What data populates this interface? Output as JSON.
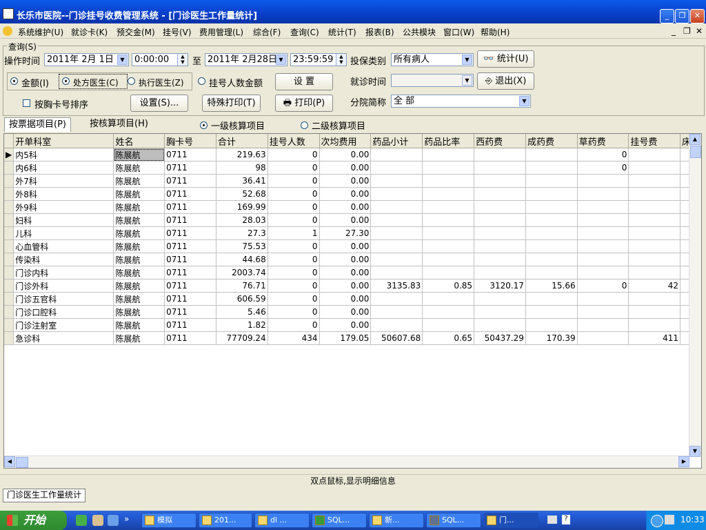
{
  "window": {
    "title": "长乐市医院--门诊挂号收费管理系统 - [门诊医生工作量统计]"
  },
  "menu": [
    "系统维护(U)",
    "就诊卡(K)",
    "预交金(M)",
    "挂号(V)",
    "费用管理(L)",
    "综合(F)",
    "查询(C)",
    "统计(T)",
    "报表(B)",
    "公共模块",
    "窗口(W)",
    "帮助(H)"
  ],
  "query": {
    "group_label": "查询(S)",
    "op_time_label": "操作时间",
    "date_from": "2011年 2月 1日",
    "time_from": "0:00:00",
    "to_label": "至",
    "date_to": "2011年 2月28日",
    "time_to": "23:59:59",
    "insurance_label": "投保类别",
    "insurance_value": "所有病人",
    "stat_button": "统计(U)",
    "radio_amount": "金额(I)",
    "radio_rx_doctor": "处方医生(C)",
    "radio_exec_doctor": "执行医生(Z)",
    "radio_reg_count": "挂号人数金额",
    "set_button": "设  置",
    "visit_time_label": "就诊时间",
    "visit_time_value": "",
    "exit_button": "退出(X)",
    "chk_sort_card": "按胸卡号排序",
    "settings_button": "设置(S)...",
    "special_print_button": "特殊打印(T)",
    "print_button": "打印(P)",
    "branch_label": "分院简称",
    "branch_value": "全 部"
  },
  "tabs": {
    "by_receipt": "按票据项目(P)",
    "by_account": "按核算项目(H)",
    "level1": "一级核算项目",
    "level2": "二级核算项目"
  },
  "grid": {
    "columns": [
      "开单科室",
      "姓名",
      "胸卡号",
      "合计",
      "挂号人数",
      "次均费用",
      "药品小计",
      "药品比率",
      "西药费",
      "成药费",
      "草药费",
      "挂号费",
      "床"
    ],
    "rows": [
      [
        "内5科",
        "陈展航",
        "0711",
        "219.63",
        "0",
        "0.00",
        "",
        "",
        "",
        "",
        "0",
        "",
        ""
      ],
      [
        "内6科",
        "陈展航",
        "0711",
        "98",
        "0",
        "0.00",
        "",
        "",
        "",
        "",
        "0",
        "",
        ""
      ],
      [
        "外7科",
        "陈展航",
        "0711",
        "36.41",
        "0",
        "0.00",
        "",
        "",
        "",
        "",
        "",
        "",
        ""
      ],
      [
        "外8科",
        "陈展航",
        "0711",
        "52.68",
        "0",
        "0.00",
        "",
        "",
        "",
        "",
        "",
        "",
        ""
      ],
      [
        "外9科",
        "陈展航",
        "0711",
        "169.99",
        "0",
        "0.00",
        "",
        "",
        "",
        "",
        "",
        "",
        ""
      ],
      [
        "妇科",
        "陈展航",
        "0711",
        "28.03",
        "0",
        "0.00",
        "",
        "",
        "",
        "",
        "",
        "",
        ""
      ],
      [
        "儿科",
        "陈展航",
        "0711",
        "27.3",
        "1",
        "27.30",
        "",
        "",
        "",
        "",
        "",
        "",
        ""
      ],
      [
        "心血管科",
        "陈展航",
        "0711",
        "75.53",
        "0",
        "0.00",
        "",
        "",
        "",
        "",
        "",
        "",
        ""
      ],
      [
        "传染科",
        "陈展航",
        "0711",
        "44.68",
        "0",
        "0.00",
        "",
        "",
        "",
        "",
        "",
        "",
        ""
      ],
      [
        "门诊内科",
        "陈展航",
        "0711",
        "2003.74",
        "0",
        "0.00",
        "",
        "",
        "",
        "",
        "",
        "",
        ""
      ],
      [
        "门诊外科",
        "陈展航",
        "0711",
        "76.71",
        "0",
        "0.00",
        "3135.83",
        "0.85",
        "3120.17",
        "15.66",
        "0",
        "42",
        ""
      ],
      [
        "门诊五官科",
        "陈展航",
        "0711",
        "606.59",
        "0",
        "0.00",
        "",
        "",
        "",
        "",
        "",
        "",
        ""
      ],
      [
        "门诊口腔科",
        "陈展航",
        "0711",
        "5.46",
        "0",
        "0.00",
        "",
        "",
        "",
        "",
        "",
        "",
        ""
      ],
      [
        "门诊注射室",
        "陈展航",
        "0711",
        "1.82",
        "0",
        "0.00",
        "",
        "",
        "",
        "",
        "",
        "",
        ""
      ],
      [
        "急诊科",
        "陈展航",
        "0711",
        "77709.24",
        "434",
        "179.05",
        "50607.68",
        "0.65",
        "50437.29",
        "170.39",
        "",
        "411",
        ""
      ]
    ]
  },
  "hint": "双点鼠标,显示明细信息",
  "window_tab": "门诊医生工作量统计",
  "taskbar": {
    "start": "开始",
    "items": [
      "模拟",
      "201...",
      "dl ...",
      "SQL...",
      "新...",
      "SQL...",
      "门..."
    ],
    "clock": "10:33"
  }
}
